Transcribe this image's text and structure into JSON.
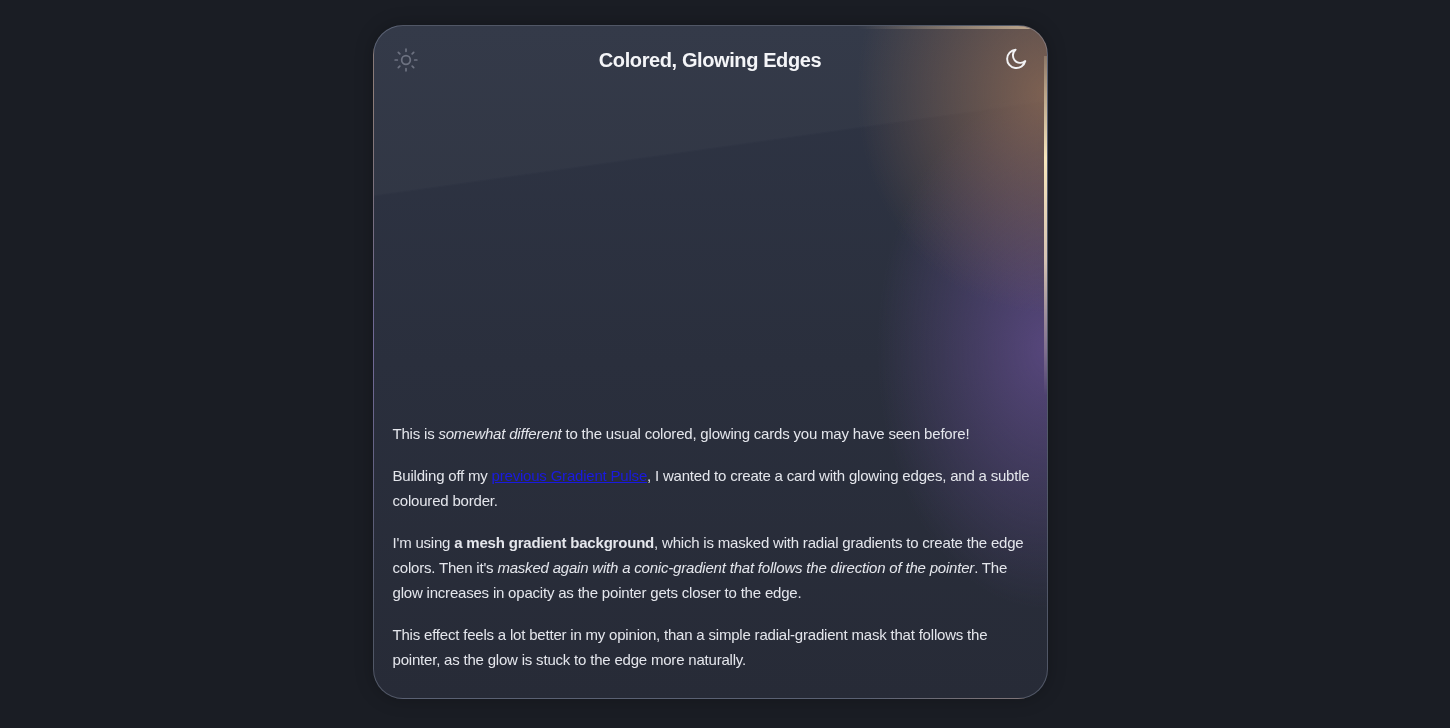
{
  "header": {
    "title": "Colored, Glowing Edges",
    "theme_options": [
      {
        "kind": "light",
        "selected": false
      },
      {
        "kind": "dark",
        "selected": true
      }
    ]
  },
  "paragraphs": [
    [
      {
        "kind": "text",
        "text": "This is *somewhat different* to the usual colored, glowing cards you may have seen before!"
      }
    ],
    [
      {
        "kind": "text",
        "text": "Building off my "
      },
      {
        "kind": "link",
        "text": "previous Gradient Pulse"
      },
      {
        "kind": "text",
        "text": ", I wanted to create a card with glowing edges, and a subtle coloured border."
      }
    ],
    [
      {
        "kind": "text",
        "text": "I'm using **a mesh gradient background**, which is masked with radial gradients to create the edge colors. Then it's *masked again with a conic-gradient that follows the direction of the pointer*. The glow increases in opacity as the pointer gets closer to the edge."
      }
    ],
    [
      {
        "kind": "text",
        "text": "This effect feels a lot better in my opinion, than a simple radial-gradient mask that follows the pointer, as the glow is stuck to the edge more naturally."
      }
    ]
  ]
}
